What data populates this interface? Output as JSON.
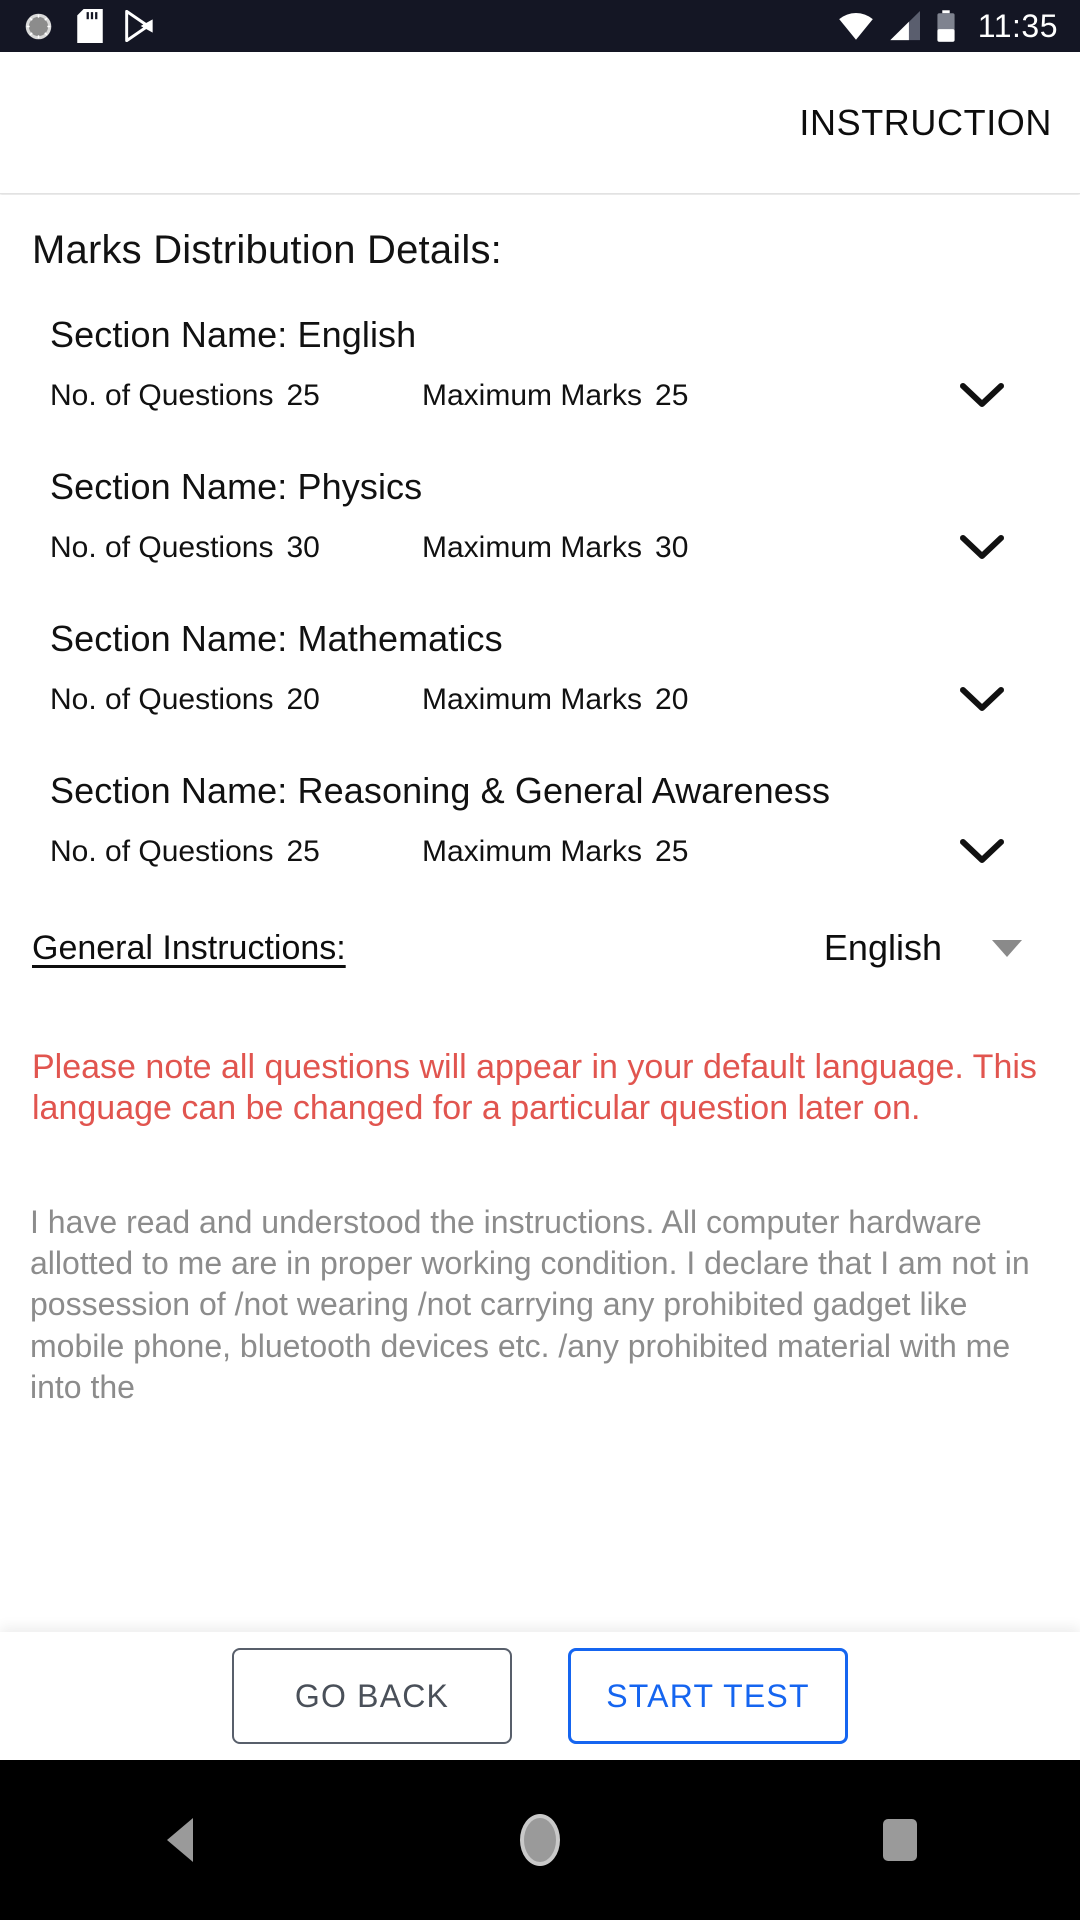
{
  "status_bar": {
    "time": "11:35",
    "left_icons": [
      "sync-progress-icon",
      "sd-card-icon",
      "play-store-icon"
    ],
    "right_icons": [
      "wifi-icon",
      "cellular-signal-icon",
      "battery-icon"
    ],
    "background_color": "#141624"
  },
  "app_bar": {
    "title": "INSTRUCTION"
  },
  "main": {
    "page_heading": "Marks Distribution Details:",
    "sections": [
      {
        "name": "Section Name: English",
        "questions_label": "No. of Questions",
        "questions_value": "25",
        "marks_label": "Maximum Marks",
        "marks_value": "25",
        "expand_icon": "chevron-down-icon"
      },
      {
        "name": "Section Name: Physics",
        "questions_label": "No. of Questions",
        "questions_value": "30",
        "marks_label": "Maximum Marks",
        "marks_value": "30",
        "expand_icon": "chevron-down-icon"
      },
      {
        "name": "Section Name: Mathematics",
        "questions_label": "No. of Questions",
        "questions_value": "20",
        "marks_label": "Maximum Marks",
        "marks_value": "20",
        "expand_icon": "chevron-down-icon"
      },
      {
        "name": "Section Name: Reasoning & General Awareness",
        "questions_label": "No. of Questions",
        "questions_value": "25",
        "marks_label": "Maximum Marks",
        "marks_value": "25",
        "expand_icon": "chevron-down-icon"
      }
    ],
    "general_instructions": {
      "label": "General Instructions:",
      "language_selected": "English",
      "dropdown_icon": "caret-down-icon"
    },
    "notice": "Please note all questions will appear in your default language. This language can be changed for a particular question later on.",
    "notice_color": "#e1554f",
    "declaration": "I have read and understood the instructions. All computer hardware allotted to me are in proper working condition.\nI declare that I am not in possession of /not wearing /not carrying any prohibited gadget like mobile phone, bluetooth devices etc. /any prohibited material with me into the",
    "declaration_color": "#8c8c8c"
  },
  "footer": {
    "go_back_label": "GO BACK",
    "start_test_label": "START TEST",
    "start_test_color": "#1565f0",
    "go_back_color": "#4a5059"
  },
  "nav_bar": {
    "items": [
      "back-nav-icon",
      "home-nav-icon",
      "recents-nav-icon"
    ],
    "background_color": "#000000"
  }
}
